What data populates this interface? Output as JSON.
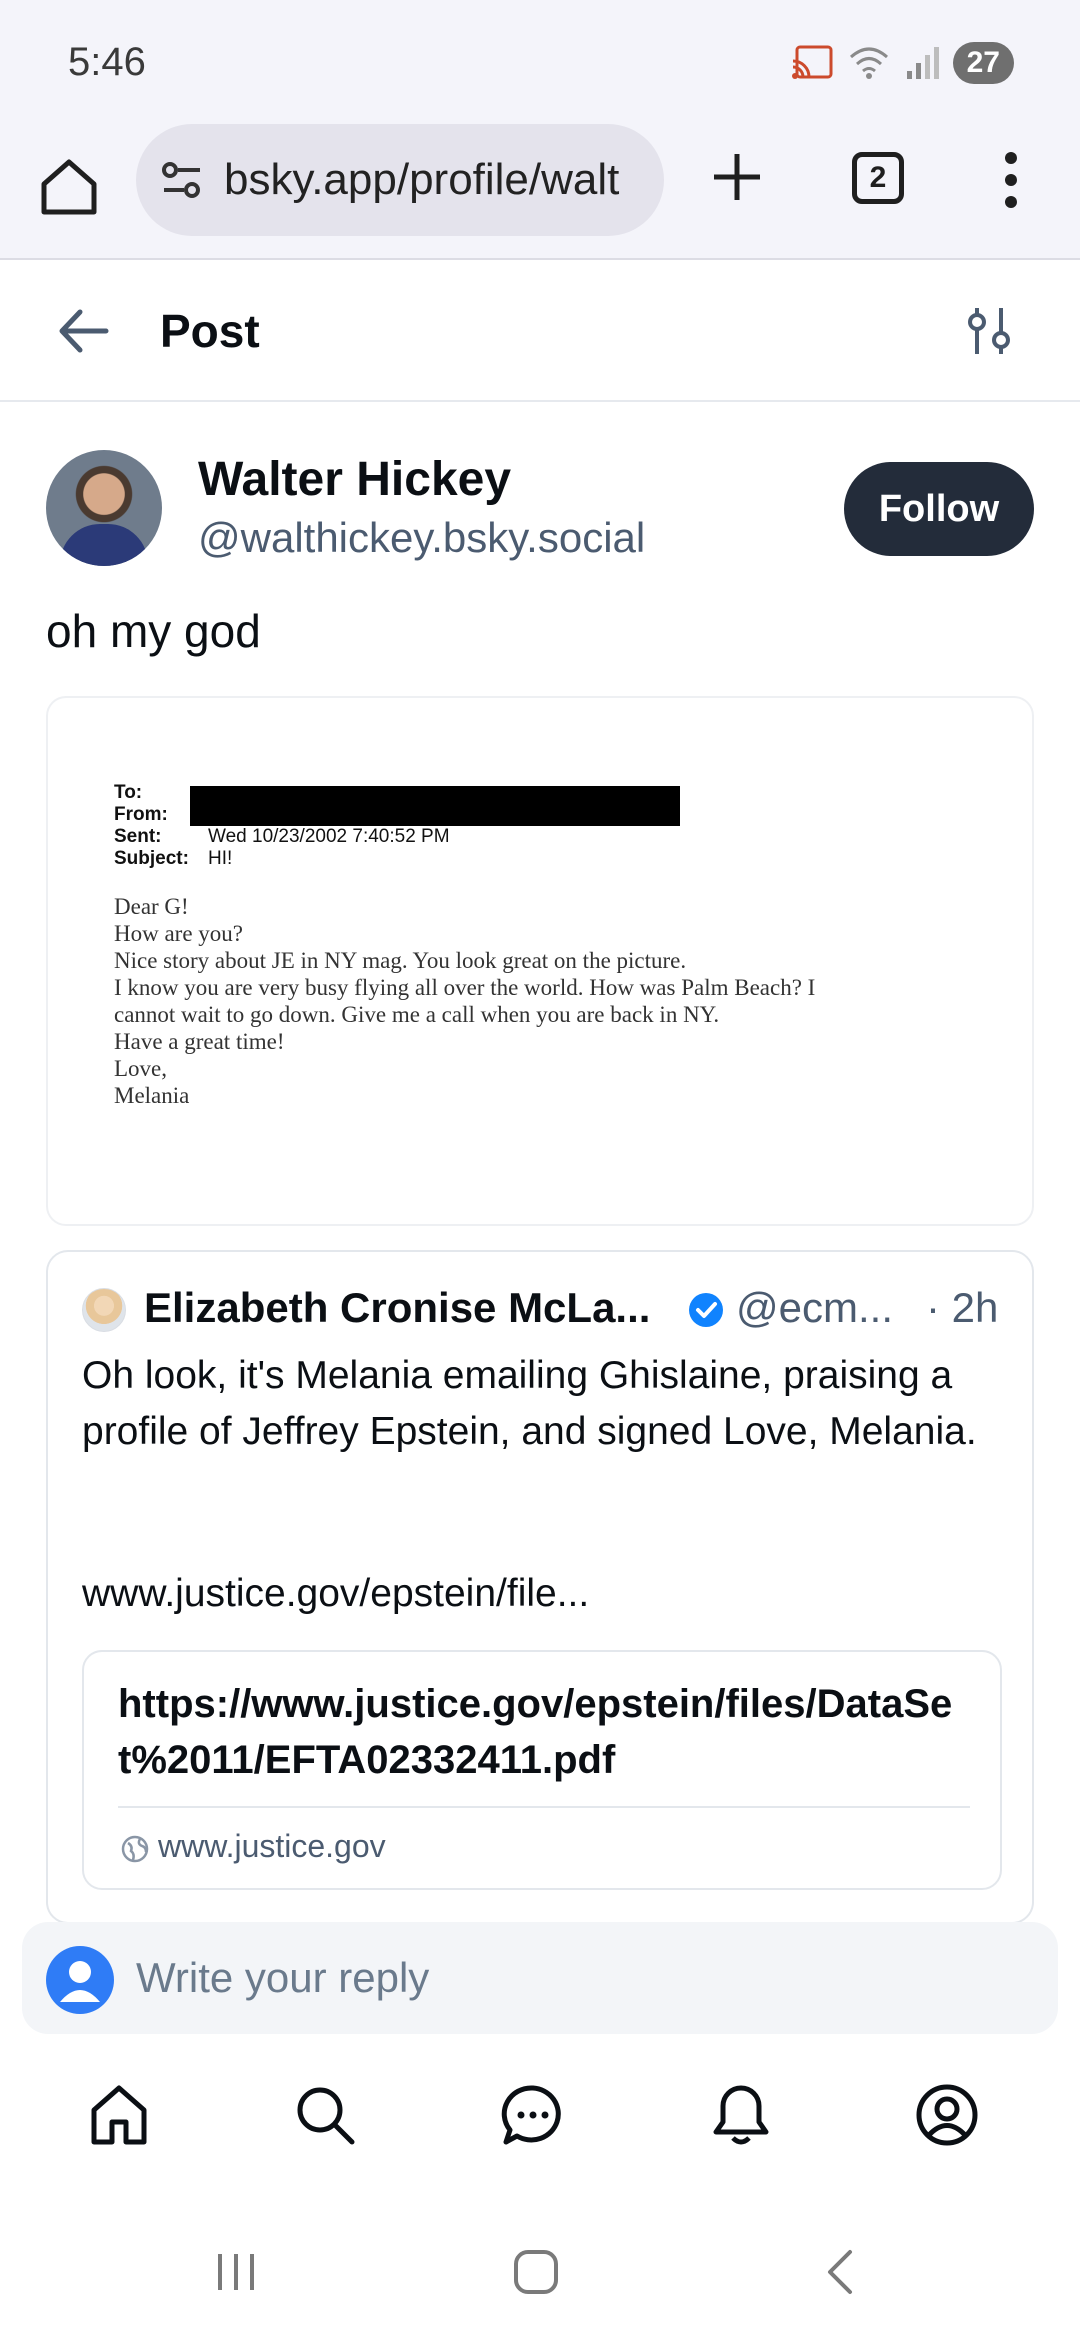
{
  "status_bar": {
    "time": "5:46",
    "battery": "27"
  },
  "browser": {
    "url": "bsky.app/profile/walt",
    "tab_count": "2"
  },
  "header": {
    "title": "Post"
  },
  "post": {
    "author_name": "Walter Hickey",
    "author_handle": "@walthickey.bsky.social",
    "follow_label": "Follow",
    "text": "oh my god"
  },
  "document": {
    "header_labels": [
      "To:",
      "From:",
      "Sent:",
      "Subject:"
    ],
    "sent_value": "Wed 10/23/2002 7:40:52 PM",
    "subject_value": "HI!",
    "body_lines": [
      "Dear G!",
      "How are you?",
      "Nice story about JE in NY mag. You look great on the picture.",
      "I know you are very busy flying all over the world. How was Palm Beach? I",
      "cannot wait to go down. Give me a call when you are back in NY.",
      "Have a great time!",
      "Love,",
      "Melania"
    ]
  },
  "quote": {
    "author_name": "Elizabeth Cronise McLa...",
    "author_handle": "@ecm...",
    "time": "· 2h",
    "text": "Oh look, it's Melania emailing Ghislaine, praising a profile of Jeffrey Epstein, and signed Love, Melania.",
    "link_text": "www.justice.gov/epstein/file...",
    "link_card": {
      "title": "https://www.justice.gov/epstein/files/DataSet%2011/EFTA02332411.pdf",
      "domain": "www.justice.gov"
    }
  },
  "reply": {
    "placeholder": "Write your reply"
  },
  "colors": {
    "accent": "#1083fe",
    "follow_bg": "#232c3a",
    "muted": "#4b5b70"
  }
}
